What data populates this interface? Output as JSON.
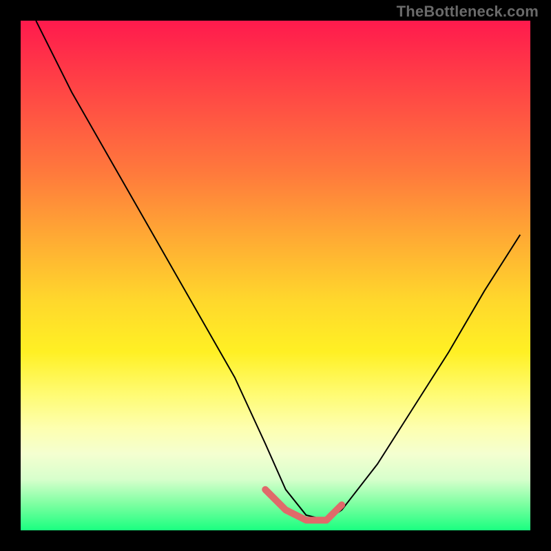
{
  "watermark": "TheBottleneck.com",
  "chart_data": {
    "type": "line",
    "title": "",
    "xlabel": "",
    "ylabel": "",
    "xlim": [
      0,
      100
    ],
    "ylim": [
      0,
      100
    ],
    "legend": false,
    "grid": false,
    "background_gradient": {
      "stops": [
        {
          "pos": 0.0,
          "color": "#ff1a4d"
        },
        {
          "pos": 0.55,
          "color": "#ffd82c"
        },
        {
          "pos": 0.85,
          "color": "#f4ffd0"
        },
        {
          "pos": 1.0,
          "color": "#1aff80"
        }
      ]
    },
    "series": [
      {
        "name": "bottleneck-curve",
        "x": [
          3,
          10,
          18,
          26,
          34,
          42,
          48,
          52,
          56,
          60,
          63,
          70,
          77,
          84,
          91,
          98
        ],
        "y": [
          100,
          86,
          72,
          58,
          44,
          30,
          17,
          8,
          3,
          2,
          4,
          13,
          24,
          35,
          47,
          58
        ]
      }
    ],
    "highlight_region": {
      "name": "optimal-range",
      "x": [
        48,
        52,
        56,
        60,
        63
      ],
      "y": [
        8,
        4,
        2,
        2,
        5
      ],
      "color": "#e06a6a"
    }
  }
}
